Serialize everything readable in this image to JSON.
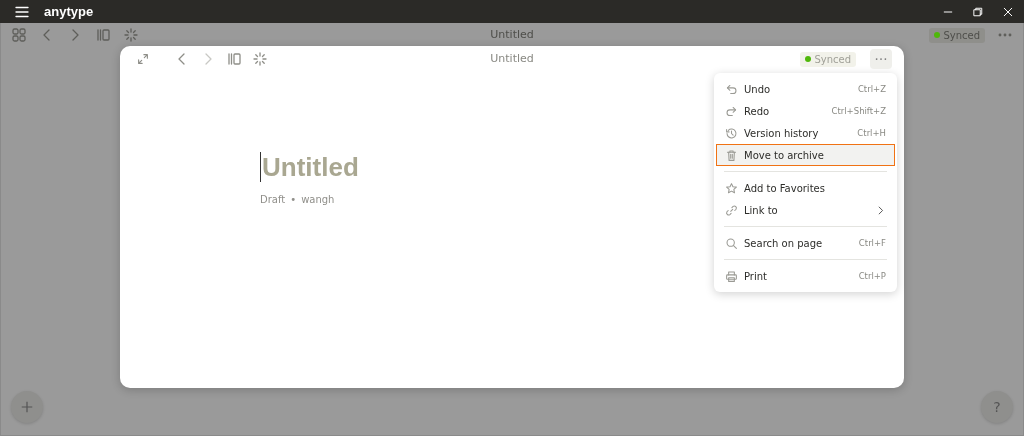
{
  "window": {
    "app_name": "anytype"
  },
  "toolbar": {
    "title": "Untitled",
    "sync_status": "Synced"
  },
  "modal": {
    "title": "Untitled",
    "sync_status": "Synced"
  },
  "document": {
    "title": "Untitled",
    "type": "Draft",
    "separator": "•",
    "author": "wangh"
  },
  "menu": {
    "sections": [
      {
        "items": [
          {
            "label": "Undo",
            "shortcut": "Ctrl+Z",
            "selected": false,
            "has_submenu": false
          },
          {
            "label": "Redo",
            "shortcut": "Ctrl+Shift+Z",
            "selected": false,
            "has_submenu": false
          },
          {
            "label": "Version history",
            "shortcut": "Ctrl+H",
            "selected": false,
            "has_submenu": false
          },
          {
            "label": "Move to archive",
            "selected": true,
            "has_submenu": false
          }
        ]
      },
      {
        "items": [
          {
            "label": "Add to Favorites",
            "selected": false,
            "has_submenu": false
          },
          {
            "label": "Link to",
            "selected": false,
            "has_submenu": true
          }
        ]
      },
      {
        "items": [
          {
            "label": "Search on page",
            "shortcut": "Ctrl+F",
            "selected": false,
            "has_submenu": false
          }
        ]
      },
      {
        "items": [
          {
            "label": "Print",
            "shortcut": "Ctrl+P",
            "selected": false,
            "has_submenu": false
          }
        ]
      }
    ]
  },
  "help_button": "?"
}
